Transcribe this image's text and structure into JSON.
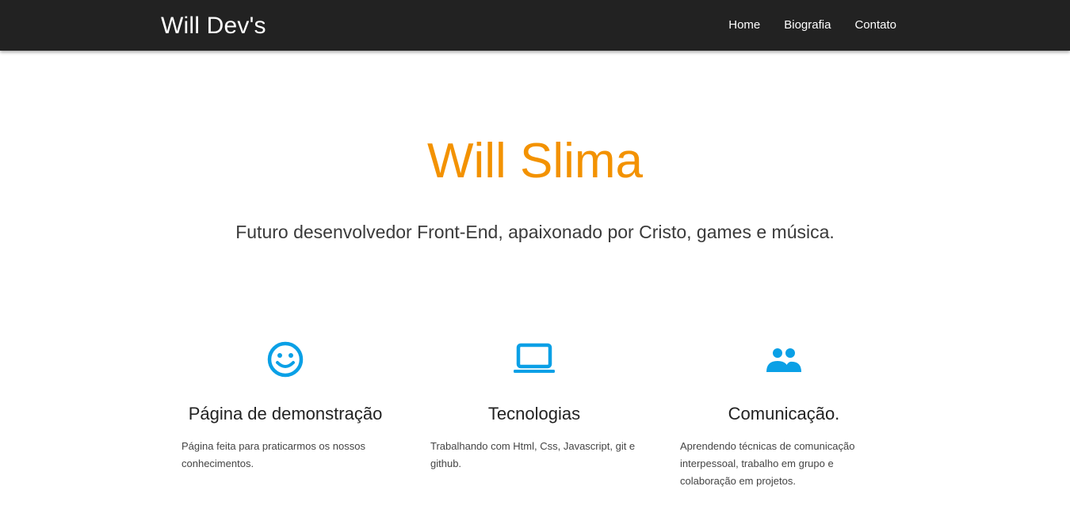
{
  "header": {
    "brand": "Will Dev's",
    "nav": [
      "Home",
      "Biografia",
      "Contato"
    ]
  },
  "hero": {
    "title": "Will Slima",
    "subtitle": "Futuro desenvolvedor Front-End, apaixonado por Cristo, games e música."
  },
  "features": [
    {
      "icon": "smiley-face-icon",
      "title": "Página de demonstração",
      "description": "Página feita para praticarmos os nossos conhecimentos."
    },
    {
      "icon": "laptop-icon",
      "title": "Tecnologias",
      "description": "Trabalhando com Html, Css, Javascript, git e github."
    },
    {
      "icon": "people-group-icon",
      "title": "Comunicação.",
      "description": "Aprendendo técnicas de comunicação interpessoal, trabalho em grupo e colaboração em projetos."
    }
  ],
  "colors": {
    "header_bg": "#222222",
    "accent_orange": "#f39200",
    "icon_blue": "#0aa0e6"
  }
}
